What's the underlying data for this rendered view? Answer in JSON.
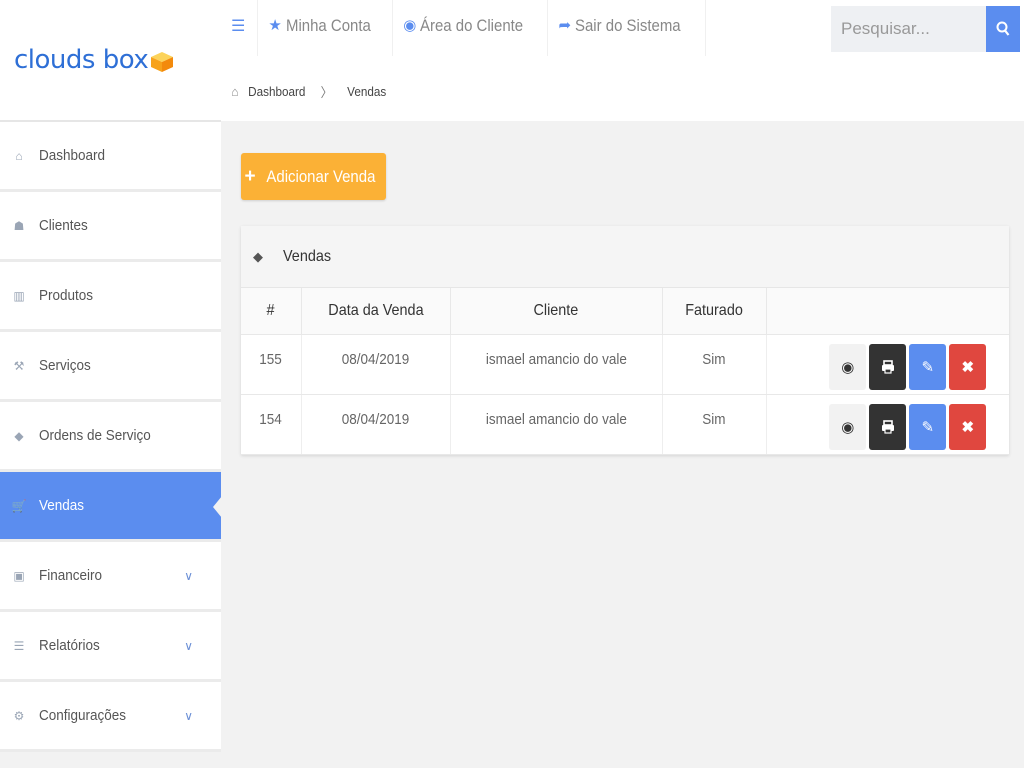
{
  "brand": {
    "logo_text": "clouds box"
  },
  "sidebar": {
    "items": [
      {
        "label": "Dashboard",
        "icon": "home-icon",
        "glyph": "⌂"
      },
      {
        "label": "Clientes",
        "icon": "users-icon",
        "glyph": "☗"
      },
      {
        "label": "Produtos",
        "icon": "barcode-icon",
        "glyph": "▥"
      },
      {
        "label": "Serviços",
        "icon": "wrench-icon",
        "glyph": "⚒"
      },
      {
        "label": "Ordens de Serviço",
        "icon": "tag-icon",
        "glyph": "◆"
      },
      {
        "label": "Vendas",
        "icon": "cart-icon",
        "glyph": "🛒",
        "active": true
      },
      {
        "label": "Financeiro",
        "icon": "money-icon",
        "glyph": "▣",
        "has_submenu": true
      },
      {
        "label": "Relatórios",
        "icon": "list-icon",
        "glyph": "☰",
        "has_submenu": true
      },
      {
        "label": "Configurações",
        "icon": "gear-icon",
        "glyph": "⚙",
        "has_submenu": true
      }
    ]
  },
  "topnav": {
    "menu_icon": "list-icon",
    "items": [
      {
        "label": "Minha Conta",
        "icon": "star-icon",
        "glyph": "★"
      },
      {
        "label": "Área do Cliente",
        "icon": "eye-icon",
        "glyph": "◉"
      },
      {
        "label": "Sair do Sistema",
        "icon": "share-icon",
        "glyph": "➦"
      }
    ],
    "search_placeholder": "Pesquisar..."
  },
  "breadcrumb": {
    "home": "Dashboard",
    "separator": "〉",
    "current": "Vendas"
  },
  "main": {
    "add_button_label": "Adicionar Venda",
    "panel_title": "Vendas",
    "table": {
      "headers": [
        "#",
        "Data da Venda",
        "Cliente",
        "Faturado",
        ""
      ],
      "rows": [
        {
          "id": "155",
          "date": "08/04/2019",
          "client": "ismael amancio do vale",
          "invoiced": "Sim"
        },
        {
          "id": "154",
          "date": "08/04/2019",
          "client": "ismael amancio do vale",
          "invoiced": "Sim"
        }
      ]
    }
  },
  "colors": {
    "accent": "#5b8def",
    "warning": "#fbb136",
    "danger": "#e0473f",
    "dark": "#333333"
  }
}
